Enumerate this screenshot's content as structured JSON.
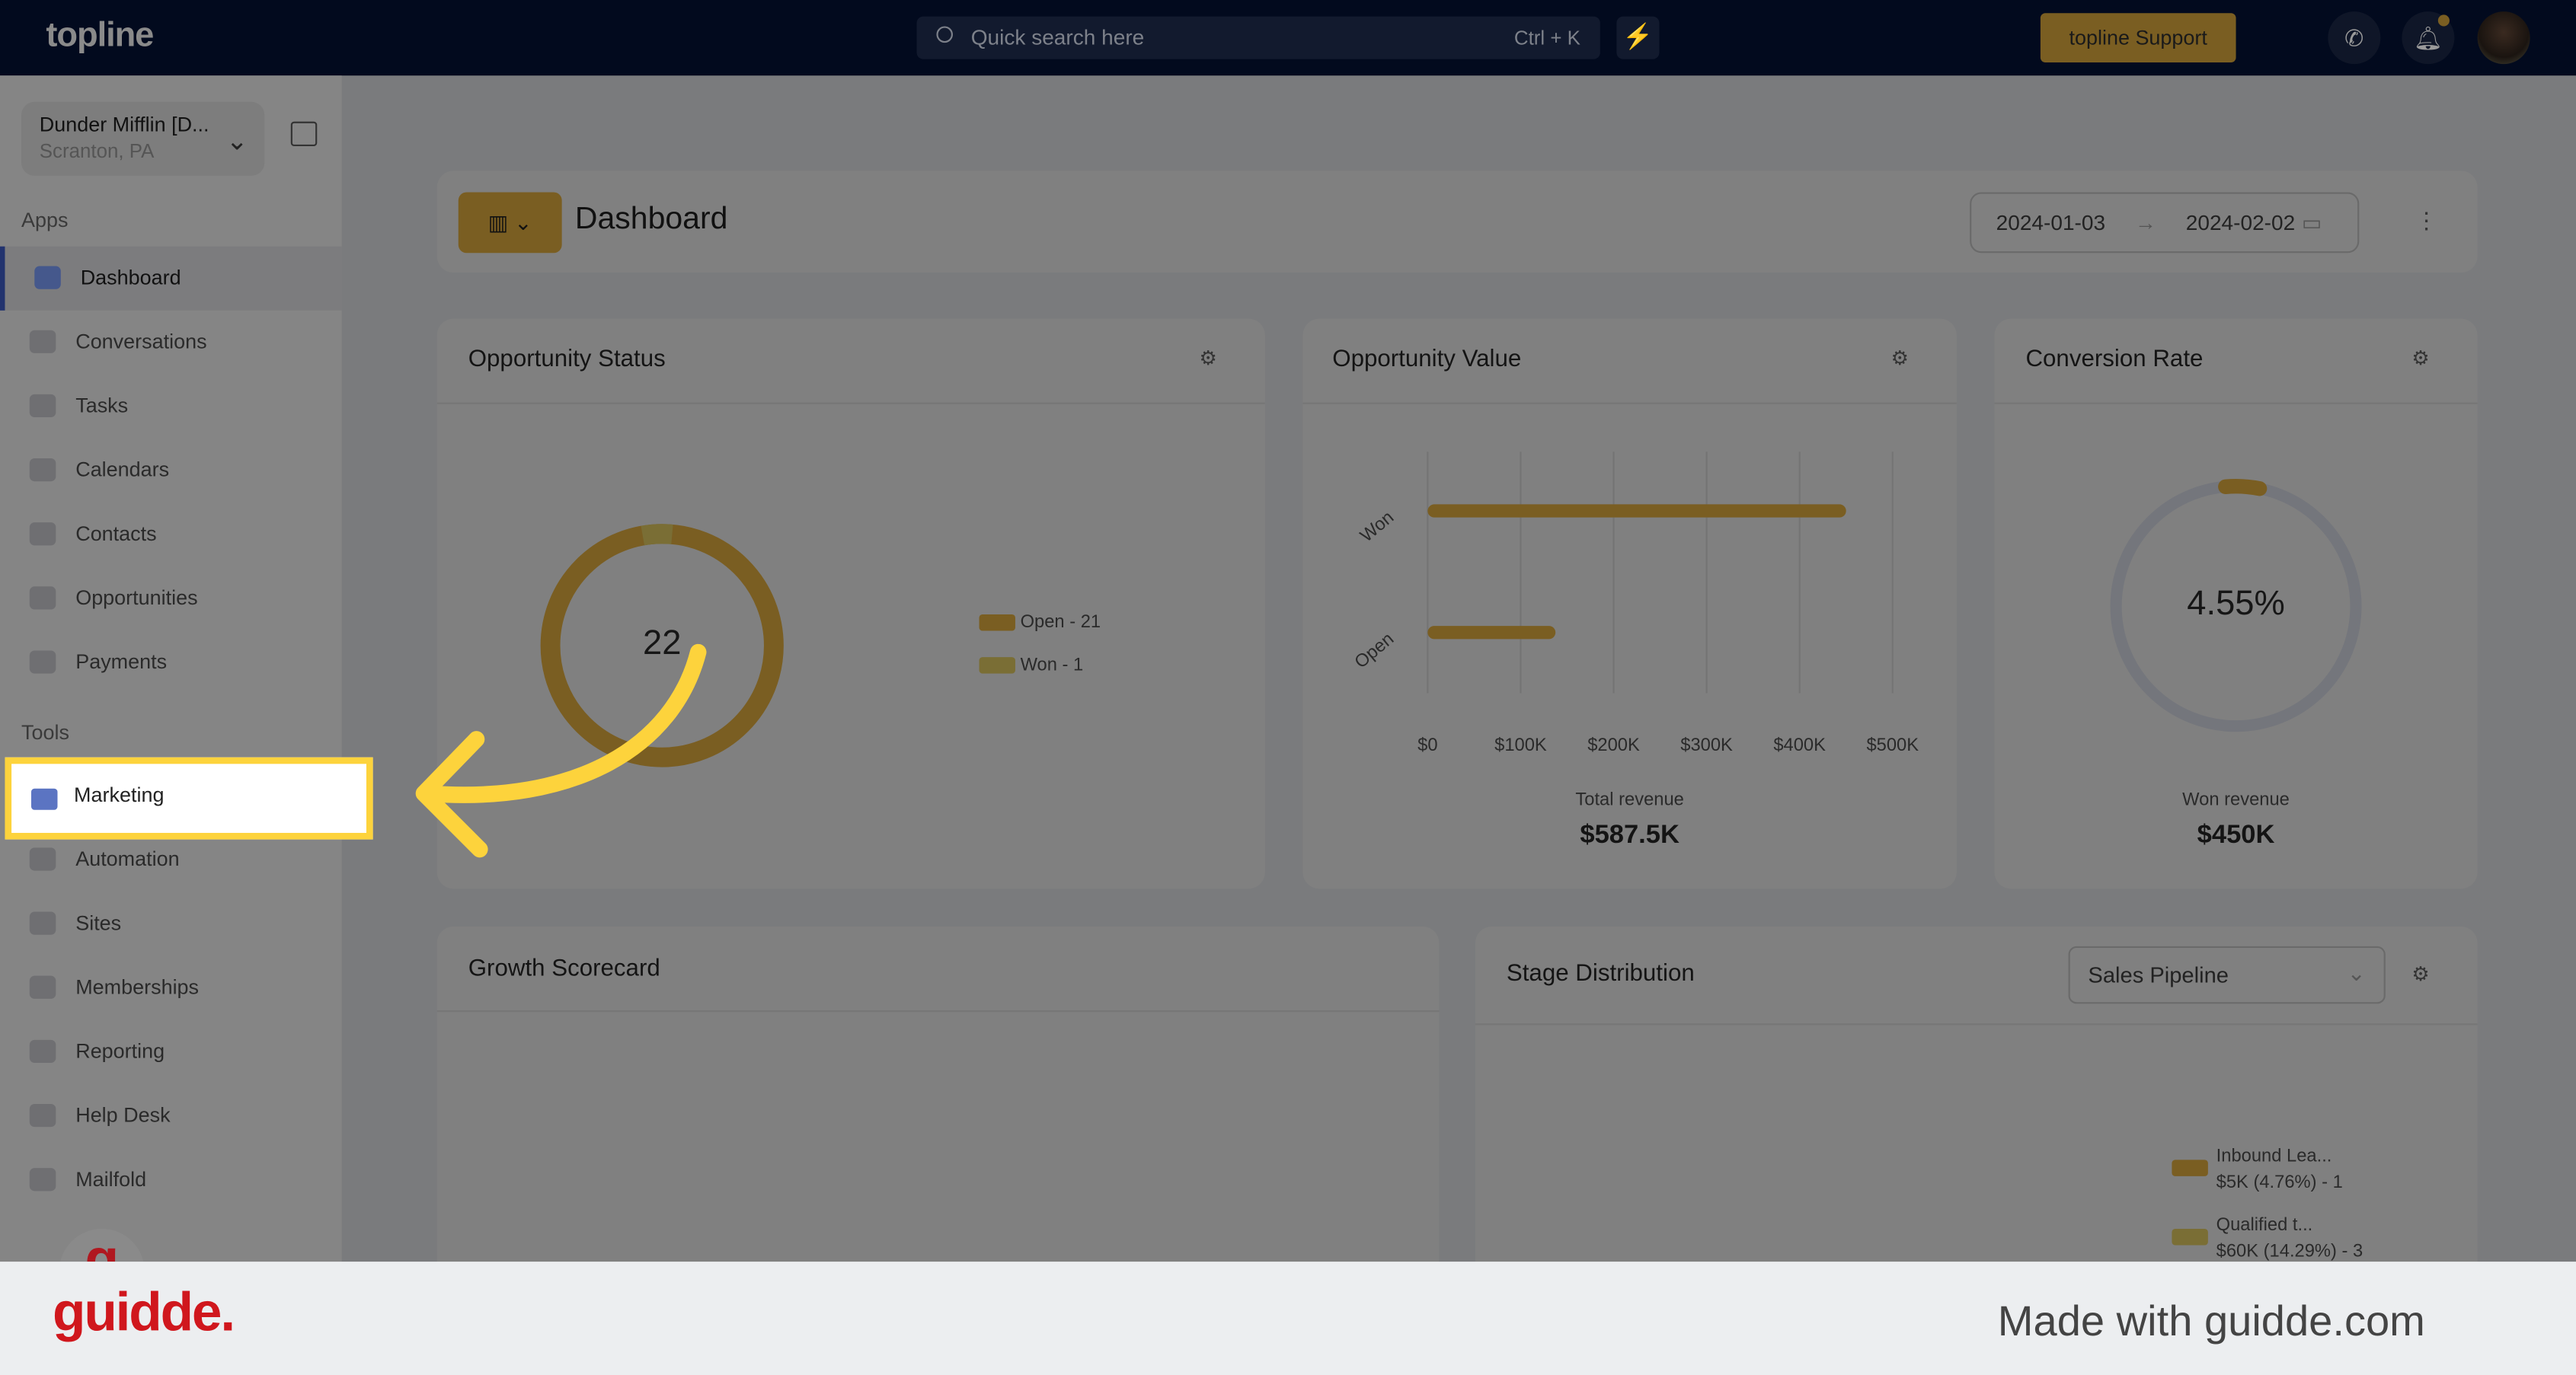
{
  "app": {
    "logo": "topline",
    "search_placeholder": "Quick search here",
    "search_shortcut": "Ctrl + K",
    "support": "topline Support"
  },
  "account": {
    "name": "Dunder Mifflin [D...",
    "location": "Scranton, PA"
  },
  "sidebar": {
    "apps_label": "Apps",
    "tools_label": "Tools",
    "apps": [
      {
        "label": "Dashboard",
        "icon": "dashboard-icon"
      },
      {
        "label": "Conversations",
        "icon": "chat-icon"
      },
      {
        "label": "Tasks",
        "icon": "tasks-icon"
      },
      {
        "label": "Calendars",
        "icon": "calendar-icon"
      },
      {
        "label": "Contacts",
        "icon": "contact-icon"
      },
      {
        "label": "Opportunities",
        "icon": "target-icon"
      },
      {
        "label": "Payments",
        "icon": "card-icon"
      }
    ],
    "tools": [
      {
        "label": "Marketing",
        "icon": "megaphone-icon"
      },
      {
        "label": "Automation",
        "icon": "gears-icon"
      },
      {
        "label": "Sites",
        "icon": "globe-icon"
      },
      {
        "label": "Memberships",
        "icon": "users-icon"
      },
      {
        "label": "Reporting",
        "icon": "pie-icon"
      },
      {
        "label": "Help Desk",
        "icon": "help-icon"
      },
      {
        "label": "Mailfold",
        "icon": "mail-icon"
      }
    ]
  },
  "header": {
    "title": "Dashboard",
    "date_from": "2024-01-03",
    "date_to": "2024-02-02"
  },
  "cards": {
    "status": {
      "title": "Opportunity Status",
      "center": "22",
      "legend": [
        "Open - 21",
        "Won - 1"
      ]
    },
    "value": {
      "title": "Opportunity Value",
      "footer_label": "Total revenue",
      "footer_value": "$587.5K"
    },
    "conversion": {
      "title": "Conversion Rate",
      "center": "4.55%",
      "footer_label": "Won revenue",
      "footer_value": "$450K"
    },
    "growth": {
      "title": "Growth Scorecard"
    },
    "stage": {
      "title": "Stage Distribution",
      "select": "Sales Pipeline",
      "legend": [
        {
          "name": "Inbound Lea...",
          "detail": "$5K (4.76%) - 1"
        },
        {
          "name": "Qualified t...",
          "detail": "$60K (14.29%) - 3"
        }
      ]
    }
  },
  "chart_data": [
    {
      "type": "pie",
      "title": "Opportunity Status",
      "categories": [
        "Open",
        "Won"
      ],
      "values": [
        21,
        1
      ],
      "colors": [
        "#7a5e22",
        "#7a6e35"
      ]
    },
    {
      "type": "bar",
      "title": "Opportunity Value",
      "orientation": "horizontal",
      "categories": [
        "Won",
        "Open"
      ],
      "values": [
        450000,
        137500
      ],
      "xticks": [
        "$0",
        "$100K",
        "$200K",
        "$300K",
        "$400K",
        "$500K"
      ],
      "xlim": [
        0,
        500000
      ],
      "grid": true
    },
    {
      "type": "pie",
      "title": "Conversion Rate",
      "values": [
        4.55,
        95.45
      ]
    }
  ],
  "colors": {
    "accent": "#fdd33c",
    "brand_gold": "#7a5e22",
    "topbar": "#020a1e"
  },
  "footer": {
    "brand": "guidde.",
    "tagline": "Made with guidde.com"
  }
}
